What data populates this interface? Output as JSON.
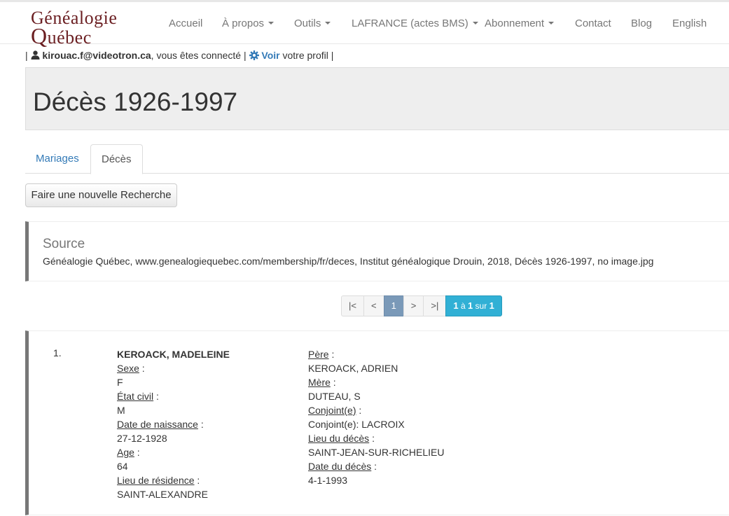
{
  "logo": {
    "line1": "Généalogie",
    "line2_big": "Q",
    "line2_rest": "uébec"
  },
  "nav": {
    "accueil": "Accueil",
    "apropos": "À propos",
    "outils": "Outils",
    "lafrance": "LAFRANCE (actes BMS)",
    "abonnement": "Abonnement",
    "contact": "Contact",
    "blog": "Blog",
    "english": "English"
  },
  "user": {
    "pipe_left": "|",
    "email": "kirouac.f@videotron.ca",
    "connected": ", vous êtes connecté |",
    "voir": "Voir",
    "profile": "votre profil |"
  },
  "page": {
    "title": "Décès 1926-1997"
  },
  "tabs": {
    "mariages": "Mariages",
    "deces": "Décès"
  },
  "search_button": "Faire une nouvelle Recherche",
  "source": {
    "title": "Source",
    "text": "Généalogie Québec, www.genealogiequebec.com/membership/fr/deces, Institut généalogique Drouin, 2018, Décès 1926-1997, no image.jpg"
  },
  "pager": {
    "first": "|<",
    "prev": "<",
    "current": "1",
    "next": ">",
    "last": ">|",
    "info_from": "1",
    "info_a": "à",
    "info_to": "1",
    "info_sur": "sur",
    "info_total": "1"
  },
  "record": {
    "number": "1.",
    "name": "KEROACK, MADELEINE",
    "sexe_label": "Sexe",
    "sexe_value": "F",
    "etat_label": "État civil",
    "etat_value": "M",
    "naissance_label": "Date de naissance",
    "naissance_value": "27-12-1928",
    "age_label": "Age",
    "age_value": "64",
    "residence_label": "Lieu de résidence",
    "residence_value": "SAINT-ALEXANDRE",
    "pere_label": "Père",
    "pere_value": "KEROACK, ADRIEN",
    "mere_label": "Mère",
    "mere_value": "DUTEAU, S",
    "conjoint_label": "Conjoint(e)",
    "conjoint_value": "Conjoint(e): LACROIX",
    "lieu_deces_label": "Lieu du décès",
    "lieu_deces_value": "SAINT-JEAN-SUR-RICHELIEU",
    "date_deces_label": "Date du décès",
    "date_deces_value": "4-1-1993",
    "colon": " :"
  }
}
